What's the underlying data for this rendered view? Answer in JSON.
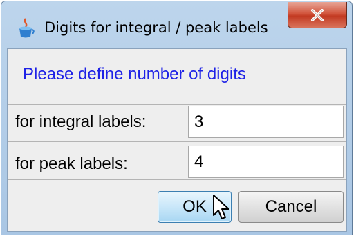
{
  "window": {
    "title": "Digits for integral / peak labels",
    "icons": {
      "app": "java-cup-icon",
      "close": "close-icon"
    }
  },
  "prompt": "Please define number of digits",
  "fields": [
    {
      "label": "for integral labels:",
      "value": "3"
    },
    {
      "label": "for peak labels:",
      "value": "4"
    }
  ],
  "buttons": {
    "ok": "OK",
    "cancel": "Cancel"
  },
  "colors": {
    "prompt_text": "#1e22e6",
    "close_button": "#c9452e",
    "ok_button_focus": "#a7d6f2",
    "window_frame": "#bdd5ec"
  }
}
